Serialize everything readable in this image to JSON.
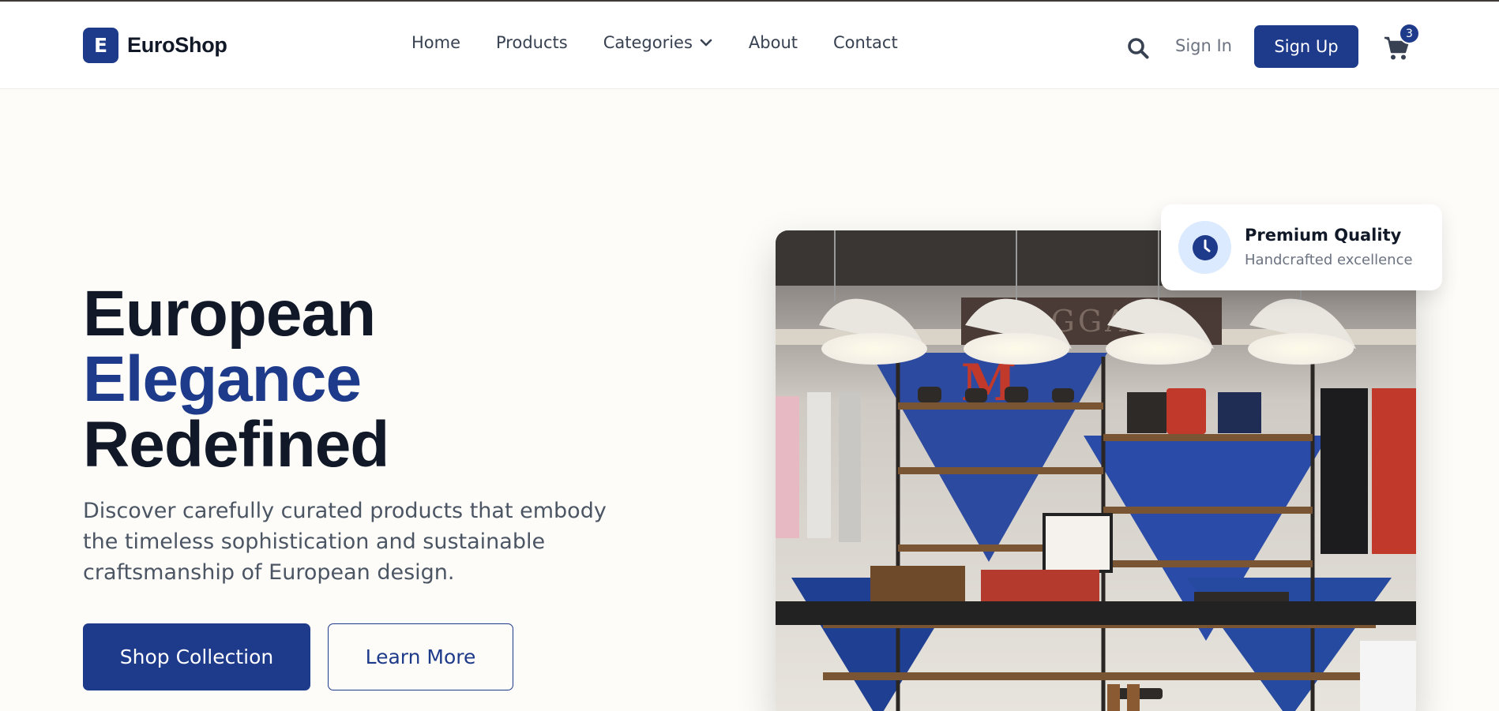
{
  "brand": {
    "mark": "E",
    "name": "EuroShop",
    "color": "#1e3a8a"
  },
  "nav": {
    "items": [
      {
        "label": "Home"
      },
      {
        "label": "Products"
      },
      {
        "label": "Categories",
        "icon": "chevron-down-icon"
      },
      {
        "label": "About"
      },
      {
        "label": "Contact"
      }
    ]
  },
  "header_actions": {
    "search_icon": "search-icon",
    "signin_label": "Sign In",
    "signup_label": "Sign Up",
    "cart_icon": "cart-icon",
    "cart_count": "3"
  },
  "hero": {
    "title_line1": "European",
    "title_line2": "Elegance",
    "title_line3": "Redefined",
    "description": "Discover carefully curated products that embody the timeless sophistication and sustainable craftsmanship of European design.",
    "primary_cta": "Shop Collection",
    "secondary_cta": "Learn More",
    "image": "store-interior-photo"
  },
  "feature_card": {
    "icon": "clock-icon",
    "title": "Premium Quality",
    "subtitle": "Handcrafted excellence"
  },
  "colors": {
    "accent": "#1e3a8a",
    "background": "#fdfcf8",
    "text": "#111827",
    "muted": "#4b5563"
  }
}
